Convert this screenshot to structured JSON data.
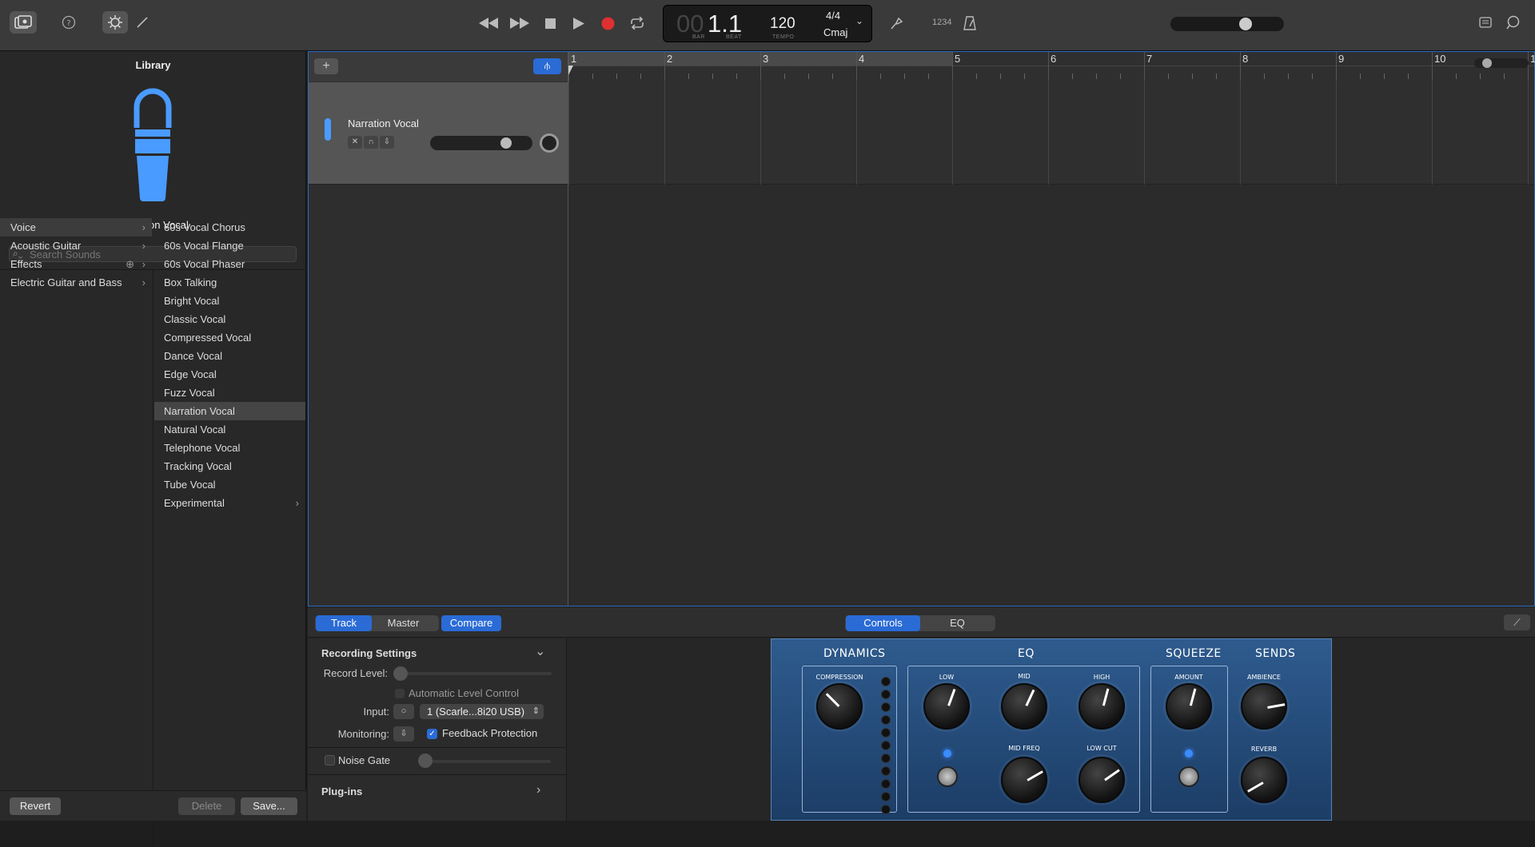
{
  "toolbar": {
    "lcd": {
      "bar_dim": "00",
      "position": "1.1",
      "bar_label": "BAR",
      "beat_label": "BEAT",
      "tempo": "120",
      "tempo_label": "TEMPO",
      "time_sig": "4/4",
      "key": "Cmaj"
    },
    "count_in": "1234"
  },
  "library": {
    "title": "Library",
    "instrument_name": "Narration Vocal",
    "search_placeholder": "Search Sounds",
    "categories": [
      {
        "label": "Voice"
      },
      {
        "label": "Acoustic Guitar"
      },
      {
        "label": "Effects"
      },
      {
        "label": "Electric Guitar and Bass"
      }
    ],
    "items": [
      {
        "label": "60s Vocal Chorus"
      },
      {
        "label": "60s Vocal Flange"
      },
      {
        "label": "60s Vocal Phaser"
      },
      {
        "label": "Box Talking"
      },
      {
        "label": "Bright Vocal"
      },
      {
        "label": "Classic Vocal"
      },
      {
        "label": "Compressed Vocal"
      },
      {
        "label": "Dance Vocal"
      },
      {
        "label": "Edge Vocal"
      },
      {
        "label": "Fuzz Vocal"
      },
      {
        "label": "Narration Vocal"
      },
      {
        "label": "Natural Vocal"
      },
      {
        "label": "Telephone Vocal"
      },
      {
        "label": "Tracking Vocal"
      },
      {
        "label": "Tube Vocal"
      },
      {
        "label": "Experimental"
      }
    ],
    "selected_item": "Narration Vocal",
    "revert": "Revert",
    "delete": "Delete",
    "save": "Save..."
  },
  "track": {
    "name": "Narration Vocal"
  },
  "ruler": {
    "bars": [
      "1",
      "2",
      "3",
      "4",
      "5",
      "6",
      "7",
      "8",
      "9",
      "10",
      "1"
    ]
  },
  "bottom": {
    "tabs": {
      "track": "Track",
      "master": "Master",
      "compare": "Compare",
      "controls": "Controls",
      "eq": "EQ"
    },
    "recording_settings": "Recording Settings",
    "record_level": "Record Level:",
    "auto_level": "Automatic Level Control",
    "input_label": "Input:",
    "input_value": "1 (Scarle...8i20 USB)",
    "monitoring_label": "Monitoring:",
    "feedback": "Feedback Protection",
    "noise_gate": "Noise Gate",
    "plugins": "Plug-ins"
  },
  "amp": {
    "dynamics": "DYNAMICS",
    "eq": "EQ",
    "squeeze": "SQUEEZE",
    "sends": "SENDS",
    "compression": "COMPRESSION",
    "low": "LOW",
    "mid": "MID",
    "high": "HIGH",
    "mid_freq": "MID FREQ",
    "low_cut": "LOW CUT",
    "amount": "AMOUNT",
    "ambience": "AMBIENCE",
    "reverb": "REVERB"
  }
}
